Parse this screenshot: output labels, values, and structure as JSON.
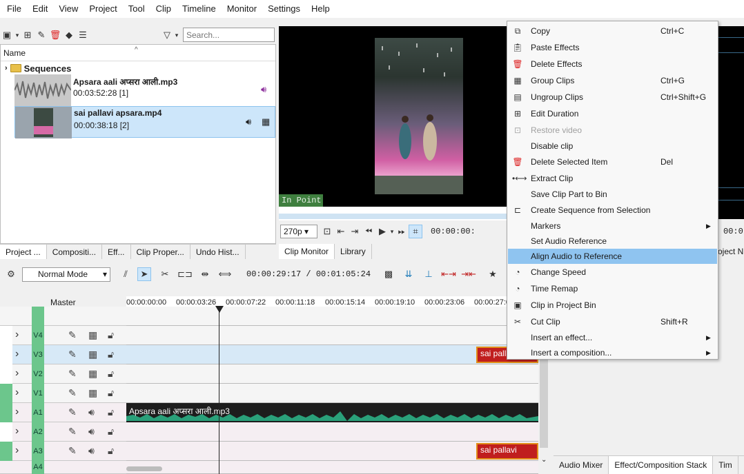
{
  "menubar": [
    "File",
    "Edit",
    "View",
    "Project",
    "Tool",
    "Clip",
    "Timeline",
    "Monitor",
    "Settings",
    "Help"
  ],
  "bin": {
    "search_placeholder": "Search...",
    "column_name": "Name",
    "folder": "Sequences",
    "clips": [
      {
        "name": "Apsara aali अप्सरा आली.mp3",
        "meta": "00:03:52:28 [1]"
      },
      {
        "name": "sai pallavi apsara.mp4",
        "meta": "00:00:38:18 [2]"
      }
    ]
  },
  "left_tabs": [
    "Project ...",
    "Compositi...",
    "Eff...",
    "Clip Proper...",
    "Undo Hist..."
  ],
  "monitor": {
    "in_point": "In Point",
    "zoom": "270p",
    "timecode": "00:00:00:",
    "tabs": [
      "Clip Monitor",
      "Library"
    ],
    "right_timecode": "00:0",
    "right_tab": "oject N"
  },
  "timeline": {
    "mode": "Normal Mode",
    "timecode": "00:00:29:17 / 00:01:05:24",
    "master_label": "Master",
    "ticks": [
      "00:00:00:00",
      "00:00:03:26",
      "00:00:07:22",
      "00:00:11:18",
      "00:00:15:14",
      "00:00:19:10",
      "00:00:23:06",
      "00:00:27:0"
    ],
    "tracks": [
      "V4",
      "V3",
      "V2",
      "V1",
      "A1",
      "A2",
      "A3",
      "A4"
    ],
    "clip_v3": "sai pallav",
    "clip_a1": "Apsara aali अप्सरा आली.mp3",
    "clip_a3": "sai pallavi apsara"
  },
  "bottom_tabs": [
    "Audio Mixer",
    "Effect/Composition Stack",
    "Tim"
  ],
  "context_menu": [
    {
      "label": "Copy",
      "shortcut": "Ctrl+C",
      "icon": "copy-icon"
    },
    {
      "label": "Paste Effects",
      "shortcut": "",
      "icon": "paste-icon"
    },
    {
      "label": "Delete Effects",
      "shortcut": "",
      "icon": "trash-icon"
    },
    {
      "label": "Group Clips",
      "shortcut": "Ctrl+G",
      "icon": "group-icon"
    },
    {
      "label": "Ungroup Clips",
      "shortcut": "Ctrl+Shift+G",
      "icon": "ungroup-icon"
    },
    {
      "label": "Edit Duration",
      "shortcut": "",
      "icon": "duration-icon"
    },
    {
      "label": "Restore video",
      "shortcut": "",
      "icon": "restore-icon"
    },
    {
      "label": "Disable clip",
      "shortcut": "",
      "icon": ""
    },
    {
      "label": "Delete Selected Item",
      "shortcut": "Del",
      "icon": "trash-icon"
    },
    {
      "label": "Extract Clip",
      "shortcut": "",
      "icon": "extract-icon"
    },
    {
      "label": "Save Clip Part to Bin",
      "shortcut": "",
      "icon": ""
    },
    {
      "label": "Create Sequence from Selection",
      "shortcut": "",
      "icon": "sequence-icon"
    },
    {
      "label": "Markers",
      "shortcut": "",
      "icon": ""
    },
    {
      "label": "Set Audio Reference",
      "shortcut": "",
      "icon": ""
    },
    {
      "label": "Align Audio to Reference",
      "shortcut": "",
      "icon": ""
    },
    {
      "label": "Change Speed",
      "shortcut": "",
      "icon": "speed-icon"
    },
    {
      "label": "Time Remap",
      "shortcut": "",
      "icon": "remap-icon"
    },
    {
      "label": "Clip in Project Bin",
      "shortcut": "",
      "icon": "bin-icon"
    },
    {
      "label": "Cut Clip",
      "shortcut": "Shift+R",
      "icon": "scissors-icon"
    },
    {
      "label": "Insert an effect...",
      "shortcut": "",
      "icon": ""
    },
    {
      "label": "Insert a composition...",
      "shortcut": "",
      "icon": ""
    }
  ]
}
